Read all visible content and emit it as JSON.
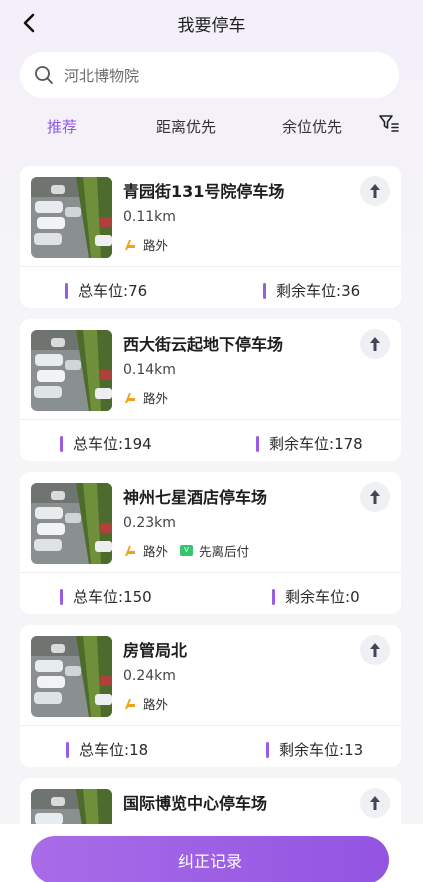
{
  "header": {
    "title": "我要停车"
  },
  "search": {
    "text": "河北博物院"
  },
  "filters": [
    {
      "label": "推荐",
      "active": true
    },
    {
      "label": "距离优先",
      "active": false
    },
    {
      "label": "余位优先",
      "active": false
    }
  ],
  "stats_labels": {
    "total": "总车位:",
    "remaining": "剩余车位:"
  },
  "lots": [
    {
      "name": "青园街131号院停车场",
      "distance": "0.11km",
      "tag": "路外",
      "total": "76",
      "remaining": "36"
    },
    {
      "name": "西大街云起地下停车场",
      "distance": "0.14km",
      "tag": "路外",
      "total": "194",
      "remaining": "178"
    },
    {
      "name": "神州七星酒店停车场",
      "distance": "0.23km",
      "tag": "路外",
      "extra_tag": "先离后付",
      "total": "150",
      "remaining": "0"
    },
    {
      "name": "房管局北",
      "distance": "0.24km",
      "tag": "路外",
      "total": "18",
      "remaining": "13"
    },
    {
      "name": "国际博览中心停车场"
    }
  ],
  "footer": {
    "button": "纠正记录"
  },
  "colors": {
    "accent": "#8e59e3",
    "bar": "#9a5ce6",
    "tag_green": "#35c56d"
  },
  "icons": {
    "back": "chevron-left-icon",
    "search": "search-icon",
    "filter": "filter-icon",
    "navigate": "navigate-arrow-icon",
    "parking": "parking-tag-icon"
  }
}
